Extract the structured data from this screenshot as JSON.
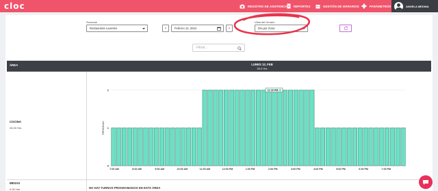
{
  "app": {
    "logo": "cloc"
  },
  "nav": {
    "items": [
      {
        "label": "REGISTRO DE ASISTENCIA",
        "icon": "camera-icon"
      },
      {
        "label": "REPORTES",
        "icon": "document-icon"
      },
      {
        "label": "GESTIÓN DE HORARIOS",
        "icon": "calendar-icon"
      },
      {
        "label": "PARÁMETROS",
        "icon": "gear-icon"
      }
    ],
    "user_name": "ANGELA MEDINA"
  },
  "filters": {
    "branch_label": "Sucursal",
    "branch_value": "Restaurante Laureles",
    "date_value": "Febrero 12, 2024",
    "view_label": "Vista del Horario",
    "view_value": "Día por Zona",
    "search_placeholder": "Filtrar..."
  },
  "table": {
    "area_header": "ÁREA",
    "day_header": "LUNES 12, FEB",
    "day_hours": "25.0 Hrs",
    "rows": [
      {
        "area": "COCINA",
        "hours": "26.00 Hrs"
      },
      {
        "area": "MESAS",
        "hours": "0.00 Hrs",
        "empty_message": "NO HAY TURNOS PROGRAMADOS EN ESTA ÁREA"
      }
    ]
  },
  "chart_data": {
    "type": "bar",
    "ylabel": "PERSONAS",
    "ylim": [
      0,
      2
    ],
    "yticks": [
      0,
      1,
      2
    ],
    "tooltip": "11:30 PM: 2",
    "x_ticks": [
      "7:00 AM",
      "8:00 AM",
      "9:00 AM",
      "10:00 AM",
      "11:00 AM",
      "12:00 PM",
      "1:00 PM",
      "2:00 PM",
      "3:00 PM",
      "4:00 PM",
      "5:00 PM",
      "6:00 PM",
      "7:00 PM"
    ],
    "series": [
      {
        "values": [
          1,
          1,
          1,
          1,
          1,
          1,
          1,
          1,
          1,
          1,
          1,
          1,
          1,
          1,
          1,
          1,
          1,
          2,
          2,
          2,
          2,
          2,
          2,
          2,
          2,
          2,
          2,
          2,
          2,
          2,
          2,
          2,
          2,
          2,
          2,
          2,
          2,
          2,
          1,
          1,
          1,
          1,
          1,
          1,
          1,
          1,
          1,
          1,
          1,
          1,
          1,
          1,
          1,
          1,
          1
        ]
      }
    ],
    "colors": {
      "bar": "#6ce0c4",
      "bar_stroke": "#2e7d6b"
    }
  }
}
